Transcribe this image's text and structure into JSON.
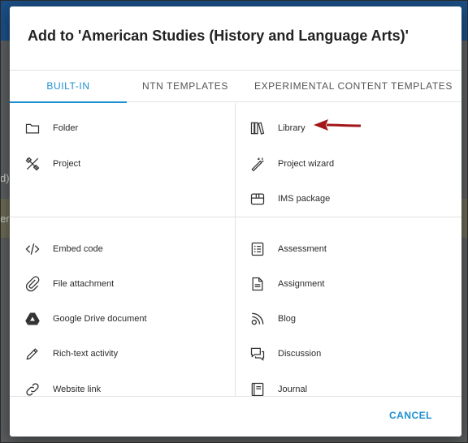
{
  "background": {
    "fragment_1": "d)",
    "fragment_2": "er"
  },
  "dialog": {
    "title": "Add to 'American Studies (History and Language Arts)'",
    "tabs": [
      {
        "label": "BUILT-IN",
        "active": true
      },
      {
        "label": "NTN TEMPLATES",
        "active": false
      },
      {
        "label": "EXPERIMENTAL CONTENT TEMPLATES",
        "active": false
      }
    ],
    "sections": {
      "top_left": [
        {
          "label": "Folder",
          "icon": "folder-icon"
        },
        {
          "label": "Project",
          "icon": "project-tools-icon"
        }
      ],
      "top_right": [
        {
          "label": "Library",
          "icon": "library-books-icon"
        },
        {
          "label": "Project wizard",
          "icon": "magic-wand-icon"
        },
        {
          "label": "IMS package",
          "icon": "package-box-icon"
        }
      ],
      "bottom_left": [
        {
          "label": "Embed code",
          "icon": "code-icon"
        },
        {
          "label": "File attachment",
          "icon": "paperclip-icon"
        },
        {
          "label": "Google Drive document",
          "icon": "google-drive-icon"
        },
        {
          "label": "Rich-text activity",
          "icon": "pencil-icon"
        },
        {
          "label": "Website link",
          "icon": "link-icon"
        }
      ],
      "bottom_right": [
        {
          "label": "Assessment",
          "icon": "checklist-icon"
        },
        {
          "label": "Assignment",
          "icon": "document-icon"
        },
        {
          "label": "Blog",
          "icon": "rss-blog-icon"
        },
        {
          "label": "Discussion",
          "icon": "chat-bubbles-icon"
        },
        {
          "label": "Journal",
          "icon": "journal-book-icon"
        }
      ]
    },
    "footer": {
      "cancel_label": "CANCEL"
    }
  },
  "colors": {
    "accent": "#1c8fd0",
    "arrow": "#a3161a",
    "header_bar": "#1b4f86"
  }
}
